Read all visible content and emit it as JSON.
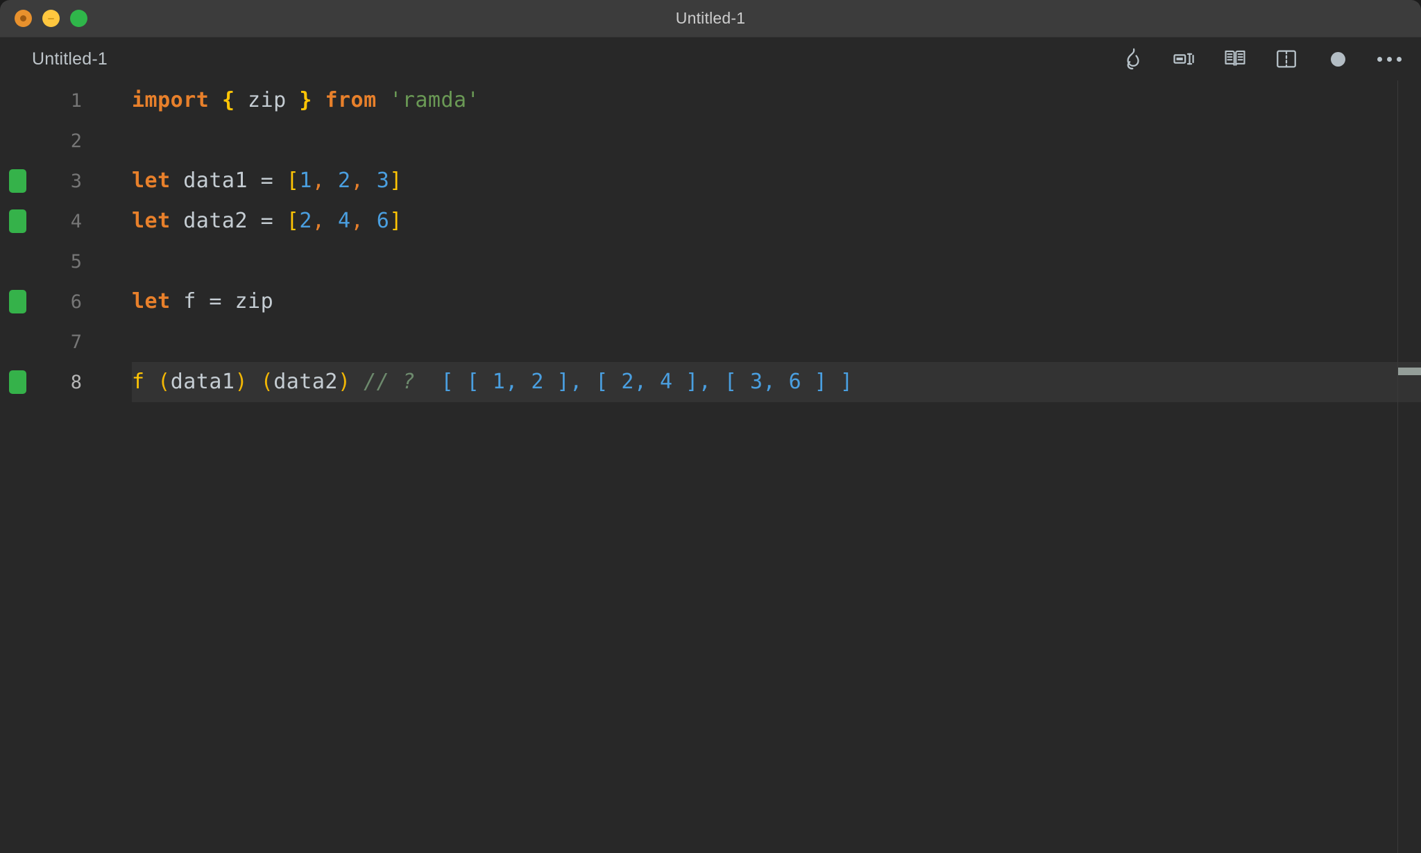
{
  "window": {
    "title": "Untitled-1",
    "controls": [
      {
        "name": "close",
        "color": "#e8912d"
      },
      {
        "name": "minimize",
        "color": "#ffc73f"
      },
      {
        "name": "maximize",
        "color": "#2fb64a"
      }
    ]
  },
  "tabbar": {
    "tab_label": "Untitled-1",
    "actions": [
      {
        "name": "quokka-run",
        "icon": "flame-icon",
        "label": "Start Quokka"
      },
      {
        "name": "rename-symbol",
        "icon": "rename-icon",
        "label": "Rename"
      },
      {
        "name": "open-preview",
        "icon": "book-icon",
        "label": "Open Preview"
      },
      {
        "name": "split-editor",
        "icon": "split-editor-icon",
        "label": "Split Editor Right"
      },
      {
        "name": "unsaved-indicator",
        "icon": "filled-circle-icon",
        "label": "Unsaved changes"
      },
      {
        "name": "more-actions",
        "icon": "ellipsis-icon",
        "label": "More Actions..."
      }
    ]
  },
  "editor": {
    "language": "javascript",
    "active_line": 8,
    "lines": [
      {
        "number": "1",
        "gutter": false,
        "active": false,
        "tokens": [
          {
            "text": "import",
            "cls": "t-kw"
          },
          {
            "text": " ",
            "cls": "t-plain"
          },
          {
            "text": "{",
            "cls": "t-curly"
          },
          {
            "text": " zip ",
            "cls": "t-plain"
          },
          {
            "text": "}",
            "cls": "t-curly"
          },
          {
            "text": " ",
            "cls": "t-plain"
          },
          {
            "text": "from",
            "cls": "t-kw"
          },
          {
            "text": " ",
            "cls": "t-plain"
          },
          {
            "text": "'ramda'",
            "cls": "t-str"
          }
        ]
      },
      {
        "number": "2",
        "gutter": false,
        "active": false,
        "tokens": []
      },
      {
        "number": "3",
        "gutter": true,
        "active": false,
        "tokens": [
          {
            "text": "let",
            "cls": "t-kw"
          },
          {
            "text": " data1 = ",
            "cls": "t-plain"
          },
          {
            "text": "[",
            "cls": "t-brack"
          },
          {
            "text": "1",
            "cls": "t-num"
          },
          {
            "text": ",",
            "cls": "t-comma"
          },
          {
            "text": " ",
            "cls": "t-plain"
          },
          {
            "text": "2",
            "cls": "t-num"
          },
          {
            "text": ",",
            "cls": "t-comma"
          },
          {
            "text": " ",
            "cls": "t-plain"
          },
          {
            "text": "3",
            "cls": "t-num"
          },
          {
            "text": "]",
            "cls": "t-brack"
          }
        ]
      },
      {
        "number": "4",
        "gutter": true,
        "active": false,
        "tokens": [
          {
            "text": "let",
            "cls": "t-kw"
          },
          {
            "text": " data2 = ",
            "cls": "t-plain"
          },
          {
            "text": "[",
            "cls": "t-brack"
          },
          {
            "text": "2",
            "cls": "t-num"
          },
          {
            "text": ",",
            "cls": "t-comma"
          },
          {
            "text": " ",
            "cls": "t-plain"
          },
          {
            "text": "4",
            "cls": "t-num"
          },
          {
            "text": ",",
            "cls": "t-comma"
          },
          {
            "text": " ",
            "cls": "t-plain"
          },
          {
            "text": "6",
            "cls": "t-num"
          },
          {
            "text": "]",
            "cls": "t-brack"
          }
        ]
      },
      {
        "number": "5",
        "gutter": false,
        "active": false,
        "tokens": []
      },
      {
        "number": "6",
        "gutter": true,
        "active": false,
        "tokens": [
          {
            "text": "let",
            "cls": "t-kw"
          },
          {
            "text": " f = zip",
            "cls": "t-plain"
          }
        ]
      },
      {
        "number": "7",
        "gutter": false,
        "active": false,
        "tokens": []
      },
      {
        "number": "8",
        "gutter": true,
        "active": true,
        "tokens": [
          {
            "text": "f",
            "cls": "t-fn"
          },
          {
            "text": " ",
            "cls": "t-plain"
          },
          {
            "text": "(",
            "cls": "t-paren"
          },
          {
            "text": "data1",
            "cls": "t-plain"
          },
          {
            "text": ")",
            "cls": "t-paren"
          },
          {
            "text": " ",
            "cls": "t-plain"
          },
          {
            "text": "(",
            "cls": "t-paren"
          },
          {
            "text": "data2",
            "cls": "t-plain"
          },
          {
            "text": ")",
            "cls": "t-paren"
          },
          {
            "text": " ",
            "cls": "t-plain"
          },
          {
            "text": "// ?",
            "cls": "t-comment"
          },
          {
            "text": "  ",
            "cls": "t-plain"
          },
          {
            "text": "[ [ 1, 2 ], [ 2, 4 ], [ 3, 6 ] ]",
            "cls": "t-result"
          }
        ]
      }
    ]
  },
  "ruler": {
    "cursor_marker_top_px": 414
  },
  "colors": {
    "titlebar_bg": "#3c3c3c",
    "editor_bg": "#282828",
    "active_line_bg": "#333333",
    "gutter_added": "#35b24a",
    "keyword": "#e8802b",
    "string": "#6a9955",
    "number": "#4a9fe0",
    "bracket": "#ffc505",
    "comment": "#6d8a6d",
    "plain_text": "#c5cdd3"
  }
}
